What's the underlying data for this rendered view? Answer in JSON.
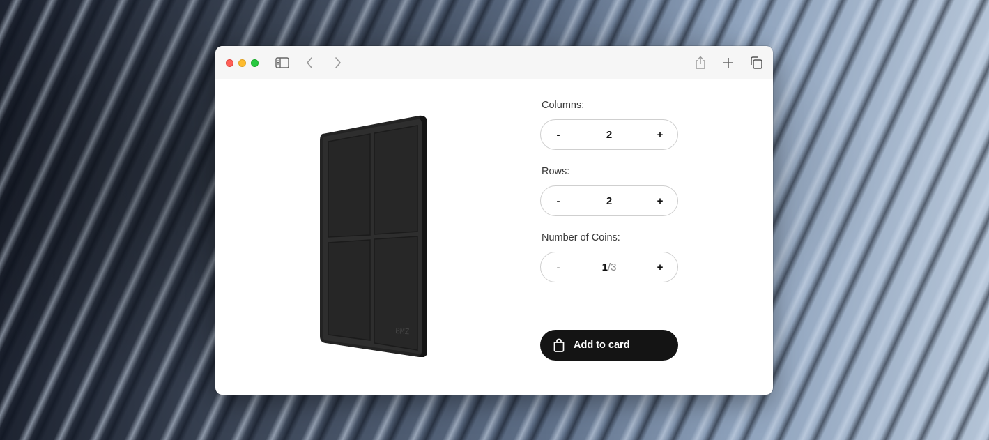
{
  "product": {
    "image_alt": "black grid tray",
    "engraving": "BMZ"
  },
  "columns": {
    "label": "Columns:",
    "decrement": "-",
    "value": "2",
    "increment": "+"
  },
  "rows": {
    "label": "Rows:",
    "decrement": "-",
    "value": "2",
    "increment": "+"
  },
  "coins": {
    "label": "Number of Coins:",
    "decrement": "-",
    "current": "1",
    "separator": "/",
    "max": "3",
    "increment": "+"
  },
  "cart": {
    "label": "Add to card",
    "icon": "shopping-bag-icon"
  },
  "colors": {
    "button_bg": "#141414",
    "accent_red": "#ff5f57",
    "accent_yellow": "#febc2e",
    "accent_green": "#28c840"
  }
}
